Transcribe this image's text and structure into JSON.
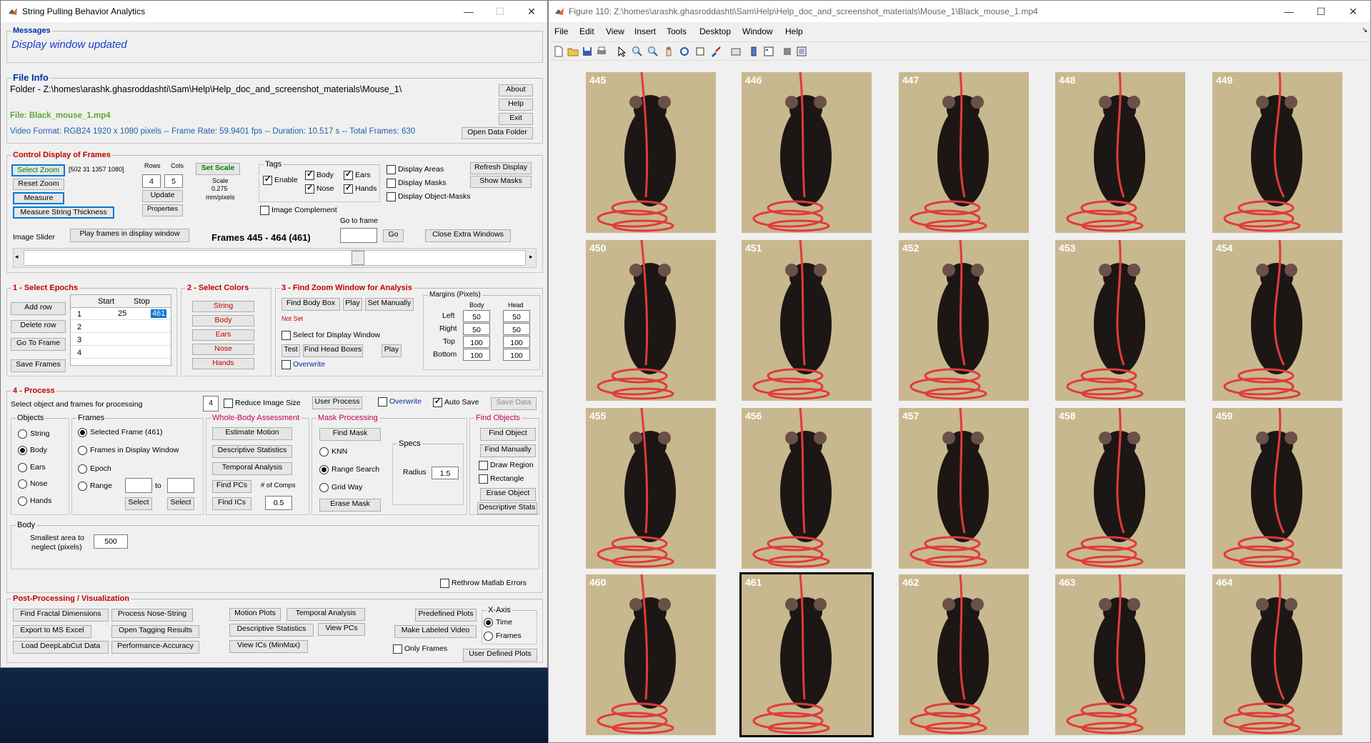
{
  "left_window": {
    "title": "String Pulling Behavior Analytics",
    "messages": {
      "title": "Messages",
      "text": "Display window updated"
    },
    "file_info": {
      "title": "File Info",
      "folder": "Folder - Z:\\homes\\arashk.ghasroddashti\\Sam\\Help\\Help_doc_and_screenshot_materials\\Mouse_1\\",
      "file": "File: Black_mouse_1.mp4",
      "video_format": "Video Format: RGB24 1920 x 1080 pixels -- Frame Rate: 59.9401 fps -- Duration: 10.517 s -- Total Frames: 630",
      "about": "About",
      "help": "Help",
      "exit": "Exit",
      "open_data": "Open Data Folder"
    },
    "control": {
      "title": "Control Display of Frames",
      "select_zoom": "Select Zoom",
      "zoom_vals": "[502 31 1357 1080]",
      "reset_zoom": "Reset Zoom",
      "measure": "Measure",
      "measure_string": "Measure String Thickness",
      "rows_lbl": "Rows",
      "cols_lbl": "Cols",
      "rows": "4",
      "cols": "5",
      "update": "Update",
      "properties": "Properties",
      "set_scale": "Set Scale",
      "scale_lbl": "Scale",
      "scale_val": "0.275",
      "scale_unit": "mm/pixels",
      "tags": "Tags",
      "enable": "Enable",
      "body": "Body",
      "ears": "Ears",
      "nose": "Nose",
      "hands": "Hands",
      "display_areas": "Display Areas",
      "display_masks": "Display Masks",
      "display_obj_masks": "Display Object-Masks",
      "refresh": "Refresh Display",
      "show_masks": "Show Masks",
      "image_complement": "Image Complement",
      "image_slider": "Image Slider",
      "play_frames": "Play frames in display window",
      "frames_label": "Frames 445 - 464 (461)",
      "go_to_frame": "Go to frame",
      "go": "Go",
      "close_extra": "Close Extra Windows",
      "slider_fraction": 0.67
    },
    "epochs": {
      "title": "1 - Select Epochs",
      "add_row": "Add row",
      "delete_row": "Delete row",
      "go_to_frame": "Go To Frame",
      "save_frames": "Save Frames",
      "col_start": "Start",
      "col_stop": "Stop",
      "rows": [
        {
          "n": "1",
          "start": "25",
          "stop": "461"
        },
        {
          "n": "2",
          "start": "",
          "stop": ""
        },
        {
          "n": "3",
          "start": "",
          "stop": ""
        },
        {
          "n": "4",
          "start": "",
          "stop": ""
        }
      ]
    },
    "colors": {
      "title": "2 - Select Colors",
      "items": [
        "String",
        "Body",
        "Ears",
        "Nose",
        "Hands"
      ]
    },
    "zoomwin": {
      "title": "3 - Find Zoom Window for Analysis",
      "find_body": "Find Body Box",
      "play": "Play",
      "set_manually": "Set Manually",
      "not_set": "Not Set",
      "select_display": "Select for Display Window",
      "test": "Test",
      "find_head": "Find Head Boxes",
      "play2": "Play",
      "overwrite": "Overwrite",
      "margins": "Margins (Pixels)",
      "body_lbl": "Body",
      "head_lbl": "Head",
      "left": "Left",
      "right": "Right",
      "top": "Top",
      "bottom": "Bottom",
      "m": {
        "left": [
          "50",
          "50"
        ],
        "right": [
          "50",
          "50"
        ],
        "top": [
          "100",
          "100"
        ],
        "bottom": [
          "100",
          "100"
        ]
      }
    },
    "process": {
      "title": "4 - Process",
      "hint": "Select object and frames for processing",
      "num": "4",
      "reduce": "Reduce Image Size",
      "user_process": "User Process",
      "overwrite": "Overwrite",
      "auto_save": "Auto Save",
      "save_data": "Save Data",
      "objects": {
        "title": "Objects",
        "items": [
          "String",
          "Body",
          "Ears",
          "Nose",
          "Hands"
        ]
      },
      "frames": {
        "title": "Frames",
        "selected": "Selected Frame (461)",
        "in_display": "Frames in Display Window",
        "epoch": "Epoch",
        "range": "Range",
        "to": "to",
        "select1": "Select",
        "select2": "Select"
      },
      "whole_body": {
        "title": "Whole-Body Assessment",
        "estimate": "Estimate Motion",
        "desc_stats": "Descriptive Statistics",
        "temporal": "Temporal Analysis",
        "find_pcs": "Find PCs",
        "n_comps_lbl": "# of Comps",
        "find_ics": "Find ICs",
        "n_comps": "0.5"
      },
      "mask": {
        "title": "Mask Processing",
        "find_mask": "Find Mask",
        "knn": "KNN",
        "range": "Range Search",
        "grid": "Grid Way",
        "erase": "Erase Mask",
        "specs": "Specs",
        "radius": "Radius",
        "radius_val": "1.5"
      },
      "find_objects": {
        "title": "Find Objects",
        "find_obj": "Find Object",
        "find_man": "Find Manually",
        "draw": "Draw Region",
        "rect": "Rectangle",
        "erase": "Erase Object",
        "desc": "Descriptive Stats"
      },
      "body": {
        "title": "Body",
        "smallest": "Smallest area to",
        "neglect": "neglect (pixels)",
        "value": "500"
      },
      "rethrow": "Rethrow Matlab Errors"
    },
    "post": {
      "title": "Post-Processing / Visualization",
      "fractal": "Find Fractal Dimensions",
      "nose_string": "Process Nose-String",
      "export": "Export to MS Excel",
      "open_tagging": "Open Tagging Results",
      "load_dlc": "Load DeepLabCut Data",
      "perf": "Performance-Accuracy",
      "motion": "Motion Plots",
      "temporal": "Temporal Analysis",
      "desc": "Descriptive Statistics",
      "view_pcs": "View PCs",
      "view_ics": "View ICs (MinMax)",
      "predefined": "Predefined Plots",
      "labeled": "Make Labeled Video",
      "only_frames": "Only Frames",
      "user_plots": "User Defined Plots",
      "xaxis": "X-Axis",
      "time": "Time",
      "frames": "Frames"
    }
  },
  "right_window": {
    "title": "Figure 110: Z:\\homes\\arashk.ghasroddashti\\Sam\\Help\\Help_doc_and_screenshot_materials\\Mouse_1\\Black_mouse_1.mp4",
    "menu": [
      "File",
      "Edit",
      "View",
      "Insert",
      "Tools",
      "Desktop",
      "Window",
      "Help"
    ],
    "frames": [
      "445",
      "446",
      "447",
      "448",
      "449",
      "450",
      "451",
      "452",
      "453",
      "454",
      "455",
      "456",
      "457",
      "458",
      "459",
      "460",
      "461",
      "462",
      "463",
      "464"
    ],
    "highlighted": "461"
  },
  "colors": {
    "accent_red": "#c00000",
    "accent_blue": "#0033a0",
    "message_blue": "#1a3ccc",
    "string_red": "#e23a3a",
    "mouse": "#1c1714",
    "bg_tile": "#c8b88f"
  }
}
